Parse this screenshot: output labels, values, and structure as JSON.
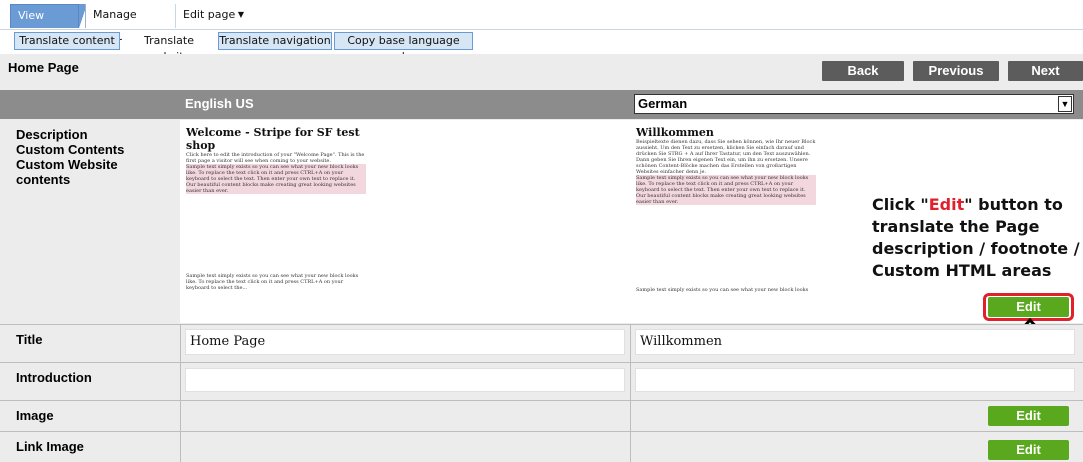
{
  "tabs": [
    {
      "label": "View Page"
    },
    {
      "label": "Manage Products"
    },
    {
      "label": "Edit page"
    }
  ],
  "actions": [
    {
      "label": "Translate content"
    },
    {
      "label": "Translate website"
    },
    {
      "label": "Translate navigation"
    },
    {
      "label": "Copy base language value"
    }
  ],
  "page": {
    "title": "Home Page",
    "nav": {
      "back": "Back",
      "previous": "Previous",
      "next": "Next"
    }
  },
  "columns": {
    "base_language": "English US",
    "target_language": "German"
  },
  "rows": {
    "description_labels": [
      "Description",
      "Custom Contents",
      "Custom Website",
      "contents"
    ],
    "title": "Title",
    "introduction": "Introduction",
    "image": "Image",
    "link_image": "Link Image"
  },
  "english_panel": {
    "heading": "Welcome - Stripe for SF test shop",
    "line1": "Click here to edit the introduction of your \"Welcome Page\". This is the first page a visitor will see when coming to your website.",
    "pink": "Sample text simply exists so you can see what your new block looks like. To replace the text click on it and press CTRL+A on your keyboard to select the text. Then enter your own text to replace it. Our beautiful content blocks make creating great looking websites easier than ever.",
    "footer": "Sample text simply exists so you can see what your new block looks like. To replace the text click on it and press CTRL+A on your keyboard to select the..."
  },
  "german_panel": {
    "heading": "Willkommen",
    "line1": "Beispieltexte dienen dazu, dass Sie sehen können, wie Ihr neuer Block aussieht. Um den Text zu ersetzen, klicken Sie einfach darauf und drücken Sie STRG + A auf Ihrer Tastatur, um den Text auszuwählen. Dann geben Sie Ihren eigenen Text ein, um ihn zu ersetzen. Unsere schönen Content-Blöcke machen das Erstellen von großartigen Websites einfacher denn je.",
    "pink": "Sample text simply exists so you can see what your new block looks like. To replace the text click on it and press CTRL+A on your keyboard to select the text. Then enter your own text to replace it. Our beautiful content blocks make creating great looking websites easier than ever.",
    "footer": "Sample text simply exists so you can see what your new block looks"
  },
  "fields": {
    "title_en": "Home Page",
    "title_de": "Willkommen"
  },
  "callout": {
    "line1_prefix": "Click \"",
    "line1_highlight": "Edit",
    "line1_suffix": "\" button to",
    "line2": "translate the Page",
    "line3": "description / footnote /",
    "line4": "Custom HTML areas"
  },
  "buttons": {
    "edit": "Edit"
  },
  "colors": {
    "tab_blue": "#6b9bd4",
    "nav_gray": "#5c5c5c",
    "edit_green": "#5aa81e",
    "highlight_red": "#e0202a"
  }
}
